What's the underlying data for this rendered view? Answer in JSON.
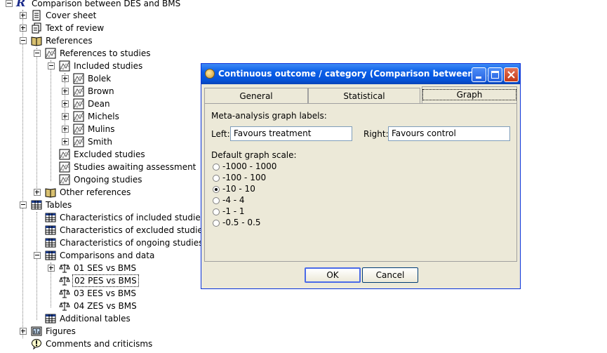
{
  "tree": {
    "root": "Comparison between DES and BMS",
    "cover_sheet": "Cover sheet",
    "text_of_review": "Text of review",
    "references": "References",
    "references_to_studies": "References to studies",
    "included_studies": "Included studies",
    "studies": [
      "Bolek",
      "Brown",
      "Dean",
      "Michels",
      "Mulins",
      "Smith"
    ],
    "excluded_studies": "Excluded studies",
    "studies_awaiting": "Studies awaiting assessment",
    "ongoing_studies": "Ongoing studies",
    "other_references": "Other references",
    "tables": "Tables",
    "char_included": "Characteristics of included studies",
    "char_excluded": "Characteristics of excluded studies",
    "char_ongoing": "Characteristics of ongoing studies",
    "comparisons": "Comparisons and data",
    "comparison_items": [
      "01 SES vs BMS",
      "02 PES vs BMS",
      "03 EES vs BMS",
      "04 ZES vs BMS"
    ],
    "additional_tables": "Additional tables",
    "figures": "Figures",
    "comments": "Comments and criticisms"
  },
  "dialog": {
    "title": "Continuous outcome / category (Comparison between D...",
    "tabs": [
      "General",
      "Statistical",
      "Graph"
    ],
    "active_tab": "Graph",
    "graph_labels_heading": "Meta-analysis graph labels:",
    "left_label": "Left:",
    "left_value": "Favours treatment",
    "right_label": "Right:",
    "right_value": "Favours control",
    "scale_heading": "Default graph scale:",
    "scale_options": [
      "-1000 - 1000",
      "-100 - 100",
      "-10 - 10",
      "-4 - 4",
      "-1 - 1",
      "-0.5 - 0.5"
    ],
    "selected_scale": "-10 - 10",
    "ok_label": "OK",
    "cancel_label": "Cancel"
  },
  "colors": {
    "titlebar": "#0553d8",
    "dialog_bg": "#ece9d8",
    "close_button": "#c43916"
  }
}
